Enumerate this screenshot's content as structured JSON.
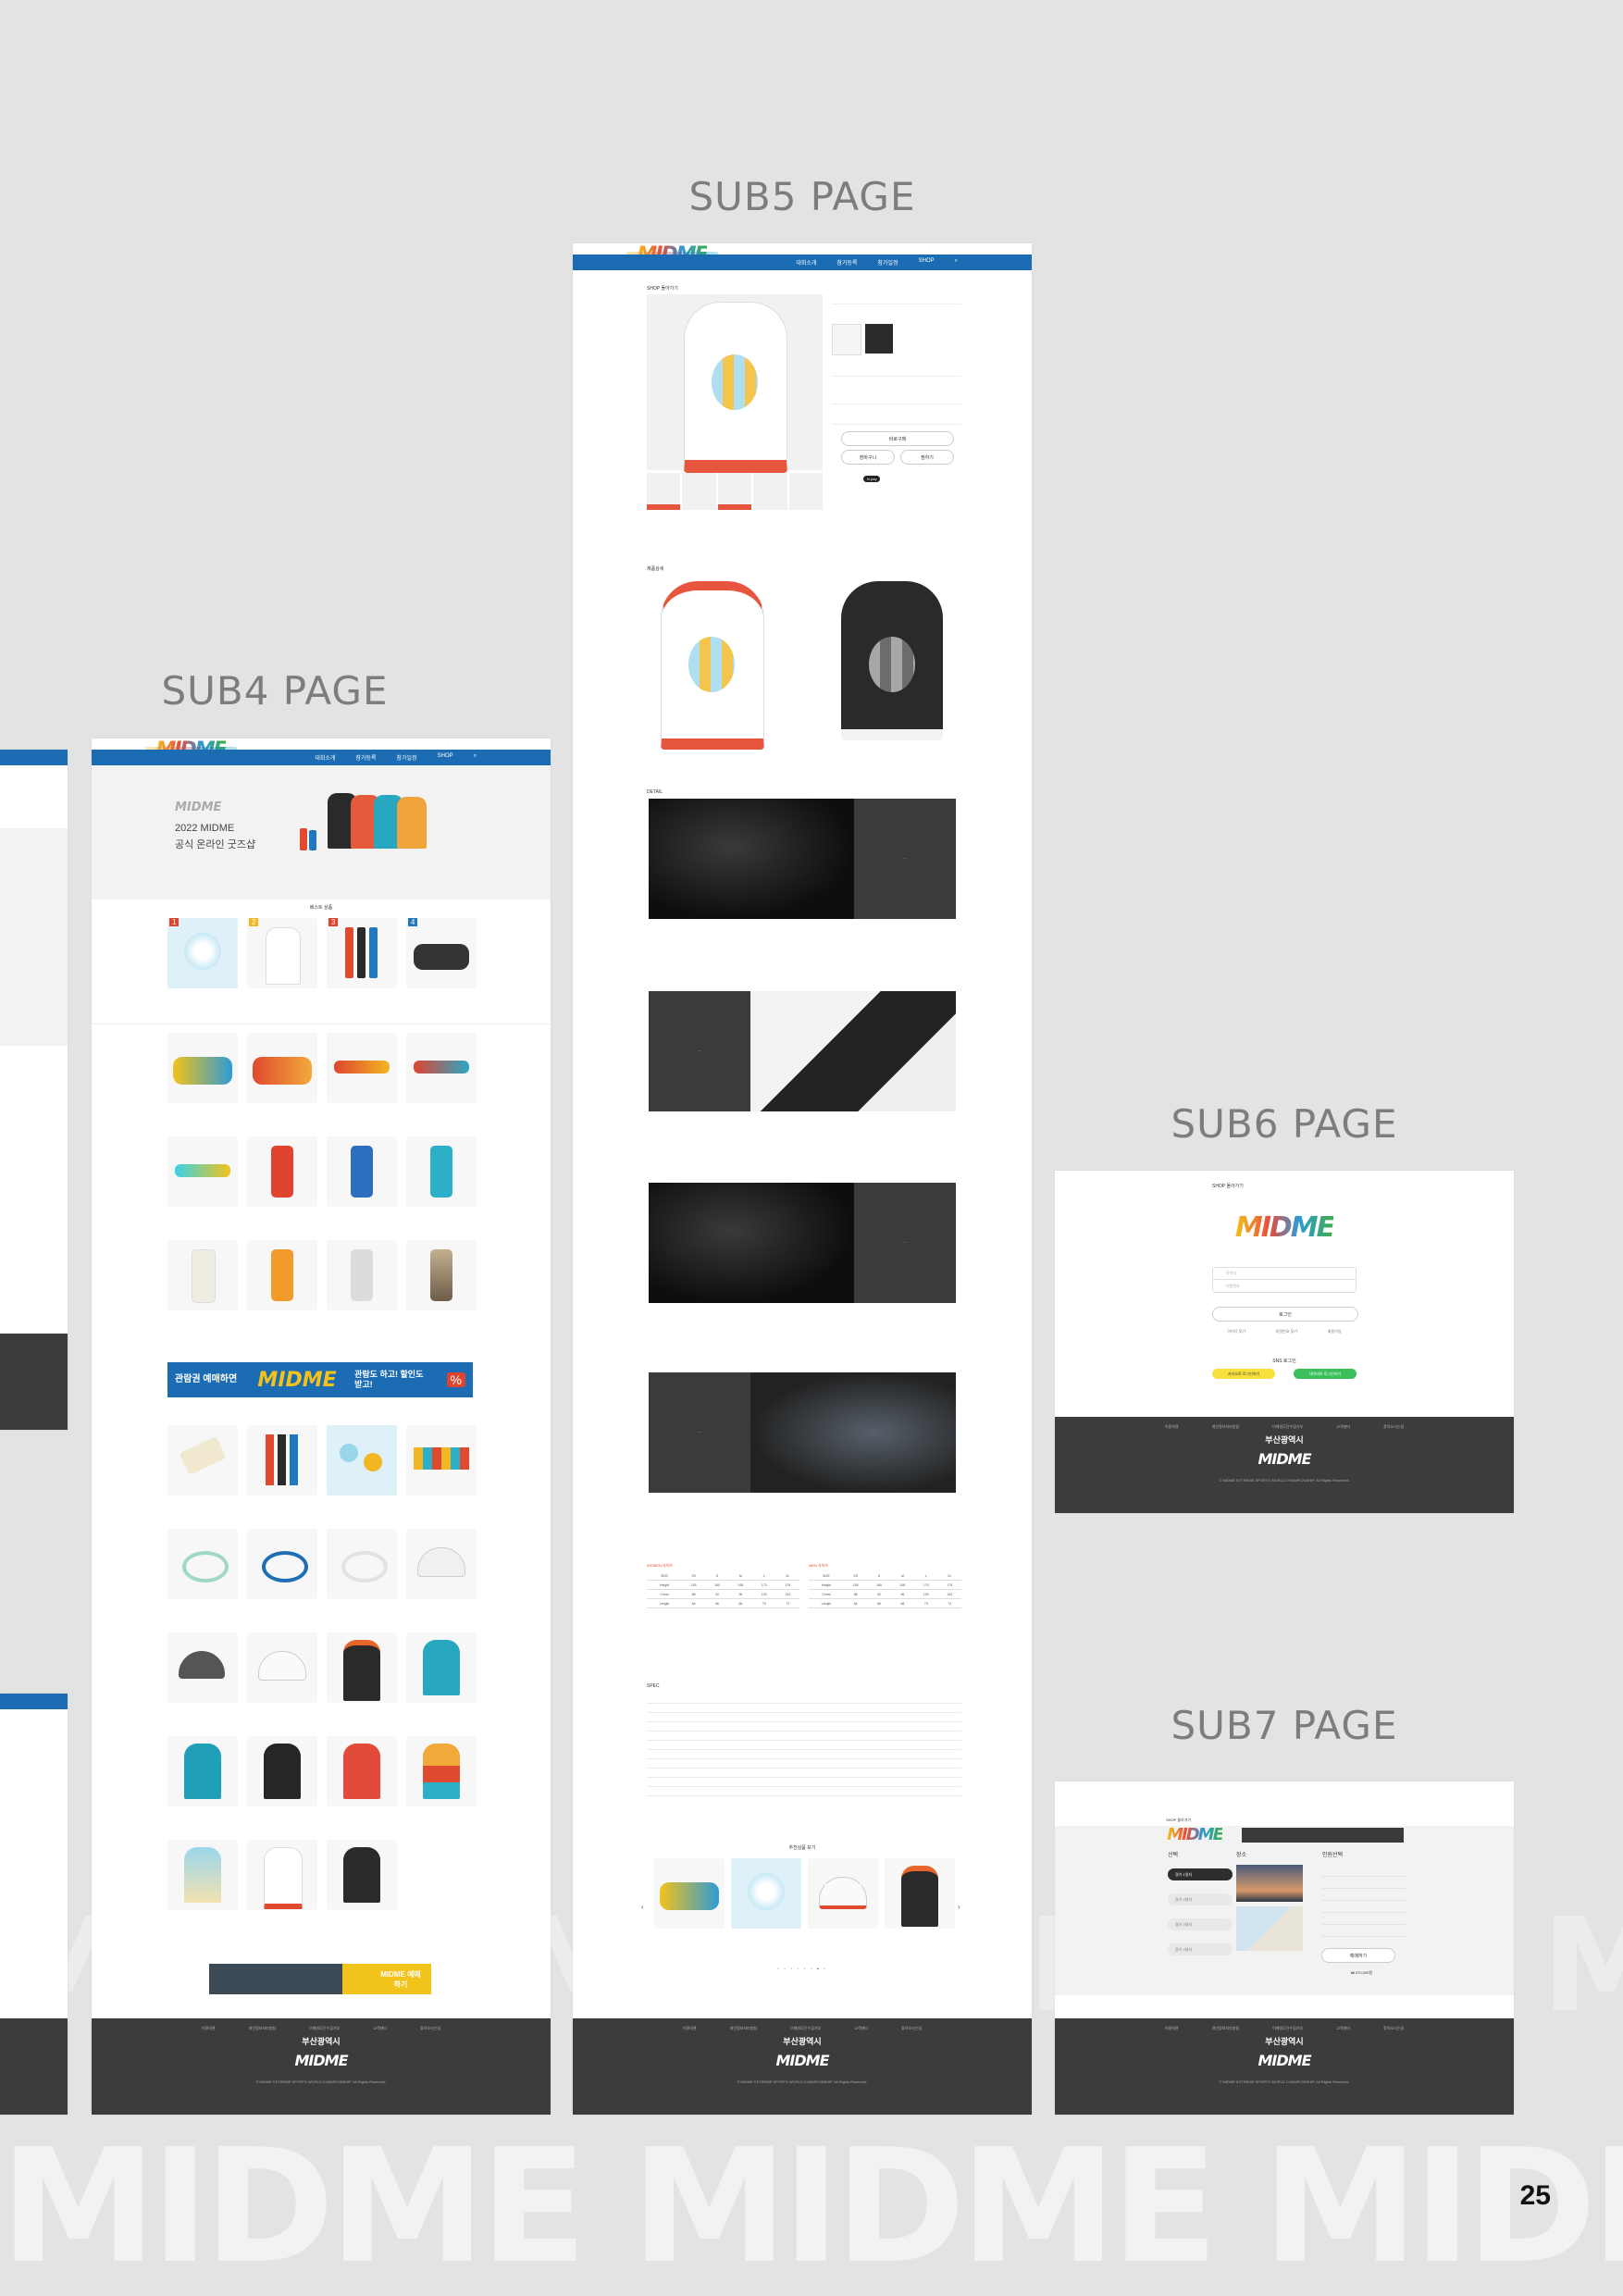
{
  "labels": {
    "sub4": "SUB4 PAGE",
    "sub5": "SUB5 PAGE",
    "sub6": "SUB6 PAGE",
    "sub7": "SUB7 PAGE"
  },
  "watermark": "MIDME MIDME MIDME MIDME",
  "page_number": "25",
  "brand": {
    "logo": "MIDME",
    "blue": "#1b6cb3",
    "dark": "#3c3c3c"
  },
  "nav": {
    "menu": [
      "대회소개",
      "참가등록",
      "참가일정",
      "SHOP"
    ]
  },
  "sub4": {
    "hero_logo": "MIDME",
    "hero_line1": "2022 MIDME",
    "hero_line2": "공식 온라인 굿즈샵",
    "best_title": "베스트 상품",
    "banner_left": "관람권 예매하면",
    "banner_mid": "MIDME",
    "banner_right": "관람도 하고! 할인도 받고!",
    "bottom_banner": "MIDME 예매하기",
    "best": [
      {
        "n": "1"
      },
      {
        "n": "2"
      },
      {
        "n": "3"
      },
      {
        "n": "4"
      }
    ]
  },
  "sub5": {
    "breadcrumb": "SHOP 돌아가기",
    "detail_title": "제품상세",
    "detail_section": "DETAIL",
    "spec_title": "SPEC",
    "related_title": "추천상품 보기",
    "buy_button": "바로구매",
    "cart_button": "장바구니",
    "wish_button": "찜하기",
    "npay": "N pay",
    "size_women": "WOMEN 사이즈",
    "size_men": "MEN 사이즈",
    "item_white": "MIDME\nWHITE 후드티",
    "item_black": "MIDME\nBLACK 후드티",
    "size_head": [
      "SIZE",
      "XS",
      "S",
      "M",
      "L",
      "XL"
    ],
    "size_rows": [
      [
        "Height",
        "155",
        "160",
        "165",
        "170",
        "175"
      ],
      [
        "Chest",
        "88",
        "92",
        "96",
        "100",
        "104"
      ],
      [
        "Length",
        "64",
        "66",
        "68",
        "70",
        "72"
      ]
    ]
  },
  "sub6": {
    "breadcrumb": "SHOP 돌아가기",
    "id_placeholder": "아이디",
    "pw_placeholder": "비밀번호",
    "login": "로그인",
    "links": [
      "아이디 찾기",
      "비밀번호 찾기",
      "회원가입"
    ],
    "sns_title": "SNS 로그인",
    "kakao": "카카오로 로그인하기",
    "naver": "네이버로 로그인하기"
  },
  "sub7": {
    "breadcrumb": "SHOP 돌아가기",
    "col1": "선택",
    "col2": "장소",
    "col3": "인원선택",
    "reserve": "예매하기",
    "price": "₩ 370,000원",
    "options": [
      "경기 1일차",
      "경기 2일차",
      "경기 3일차",
      "경기 4일차"
    ]
  },
  "footer": {
    "links": [
      "이용약관",
      "개인정보처리방침",
      "이메일무단수집거부",
      "고객센터",
      "찾아오시는길"
    ],
    "busan": "부산광역시",
    "logo": "MIDME",
    "copyright": "© MIDME EXTREME SPORTS WORLD CHAMPIONSHIP. All Rights Reserved."
  }
}
